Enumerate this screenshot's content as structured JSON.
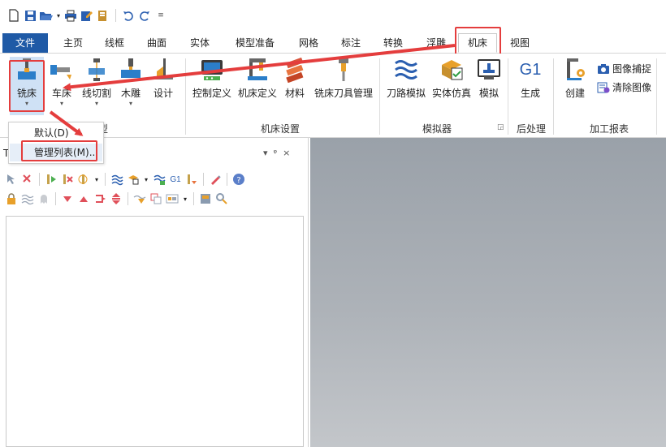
{
  "qat": {
    "icons": [
      "new-file-icon",
      "save-icon",
      "open-icon",
      "print-icon",
      "edit-icon",
      "bookmark-icon",
      "undo-icon",
      "redo-icon",
      "customize-icon"
    ]
  },
  "tabs": {
    "file": "文件",
    "home": "主页",
    "wireframe": "线框",
    "surface": "曲面",
    "solid": "实体",
    "model_prep": "模型准备",
    "mesh": "网格",
    "annotate": "标注",
    "transform": "转换",
    "relief": "浮雕",
    "machine": "机床",
    "view": "视图"
  },
  "ribbon": {
    "machine_type": {
      "mill": "铣床",
      "lathe": "车床",
      "wire": "线切割",
      "router": "木雕",
      "design": "设计",
      "group_label": "型"
    },
    "machine_setup": {
      "control_def": "控制定义",
      "machine_def": "机床定义",
      "material": "材料",
      "tool_manager": "铣床刀具管理",
      "group_label": "机床设置"
    },
    "simulator": {
      "toolpath_sim": "刀路模拟",
      "solid_sim": "实体仿真",
      "simulate": "模拟",
      "group_label": "模拟器"
    },
    "post": {
      "g1": "G1",
      "generate": "生成",
      "group_label": "后处理"
    },
    "report": {
      "create": "创建",
      "capture": "图像捕捉",
      "clear": "清除图像",
      "group_label": "加工报表"
    }
  },
  "dropdown": {
    "default": "默认(D)",
    "manage": "管理列表(M)..."
  },
  "panel": {
    "title_glyph": "T",
    "pin_glyph": "▾  ᵠ  ×"
  },
  "colors": {
    "accent_blue": "#1f5aa6",
    "highlight_red": "#e43d3d",
    "viewport_gray": "#a7acb2"
  }
}
